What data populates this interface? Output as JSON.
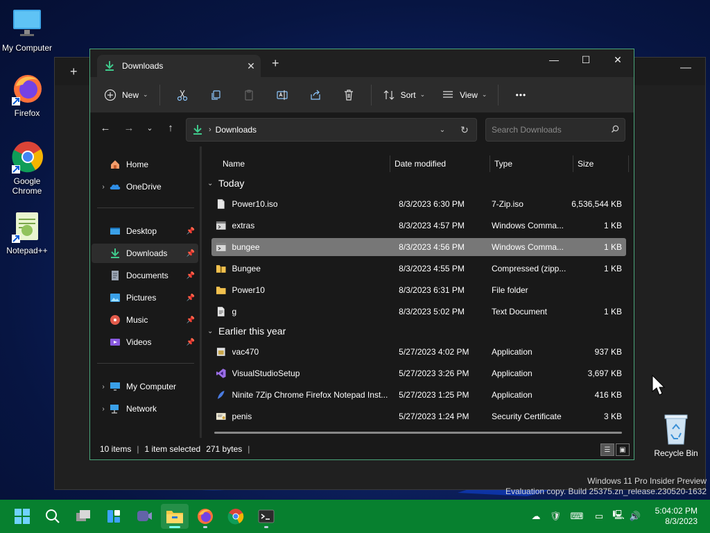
{
  "desktop": {
    "icons": [
      {
        "label": "My Computer"
      },
      {
        "label": "Firefox"
      },
      {
        "label": "Google Chrome"
      },
      {
        "label": "Notepad++"
      }
    ],
    "recycle_bin": "Recycle Bin",
    "watermark_line1": "Windows 11 Pro Insider Preview",
    "watermark_line2": "Evaluation copy. Build 25375.zn_release.230520-1632"
  },
  "explorer": {
    "tab_title": "Downloads",
    "toolbar": {
      "new_label": "New",
      "sort_label": "Sort",
      "view_label": "View",
      "more_label": "•••"
    },
    "address": {
      "crumb": "Downloads",
      "search_placeholder": "Search Downloads"
    },
    "sidebar": {
      "home": "Home",
      "onedrive": "OneDrive",
      "quick": [
        {
          "label": "Desktop"
        },
        {
          "label": "Downloads"
        },
        {
          "label": "Documents"
        },
        {
          "label": "Pictures"
        },
        {
          "label": "Music"
        },
        {
          "label": "Videos"
        }
      ],
      "mycomputer": "My Computer",
      "network": "Network"
    },
    "columns": {
      "name": "Name",
      "date": "Date modified",
      "type": "Type",
      "size": "Size"
    },
    "groups": {
      "today": "Today",
      "earlier": "Earlier this year"
    },
    "files_today": [
      {
        "name": "Power10.iso",
        "date": "8/3/2023 6:30 PM",
        "type": "7-Zip.iso",
        "size": "6,536,544 KB"
      },
      {
        "name": "extras",
        "date": "8/3/2023 4:57 PM",
        "type": "Windows Comma...",
        "size": "1 KB"
      },
      {
        "name": "bungee",
        "date": "8/3/2023 4:56 PM",
        "type": "Windows Comma...",
        "size": "1 KB"
      },
      {
        "name": "Bungee",
        "date": "8/3/2023 4:55 PM",
        "type": "Compressed (zipp...",
        "size": "1 KB"
      },
      {
        "name": "Power10",
        "date": "8/3/2023 6:31 PM",
        "type": "File folder",
        "size": ""
      },
      {
        "name": "g",
        "date": "8/3/2023 5:02 PM",
        "type": "Text Document",
        "size": "1 KB"
      }
    ],
    "files_earlier": [
      {
        "name": "vac470",
        "date": "5/27/2023 4:02 PM",
        "type": "Application",
        "size": "937 KB"
      },
      {
        "name": "VisualStudioSetup",
        "date": "5/27/2023 3:26 PM",
        "type": "Application",
        "size": "3,697 KB"
      },
      {
        "name": "Ninite 7Zip Chrome Firefox Notepad Inst...",
        "date": "5/27/2023 1:25 PM",
        "type": "Application",
        "size": "416 KB"
      },
      {
        "name": "penis",
        "date": "5/27/2023 1:24 PM",
        "type": "Security Certificate",
        "size": "3 KB"
      }
    ],
    "status": {
      "count": "10 items",
      "selected": "1 item selected",
      "bytes": "271 bytes"
    }
  },
  "taskbar": {
    "time": "5:04:02 PM",
    "date": "8/3/2023"
  },
  "colors": {
    "taskbar": "#07802f",
    "window_border": "#4aa57a",
    "selection": "#777777",
    "downloads_accent": "#3fc98b"
  }
}
